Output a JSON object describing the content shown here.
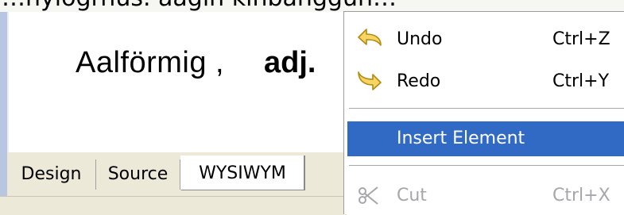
{
  "top_fragment": "…nylogrnus. aagin kinbanggun…",
  "editor": {
    "term": "Aalförmig ,",
    "part_of_speech": "adj."
  },
  "tabs": [
    {
      "label": "Design",
      "active": false
    },
    {
      "label": "Source",
      "active": false
    },
    {
      "label": "WYSIWYM",
      "active": true
    }
  ],
  "context_menu": {
    "undo": {
      "label": "Undo",
      "shortcut": "Ctrl+Z",
      "icon": "undo-arrow-icon"
    },
    "redo": {
      "label": "Redo",
      "shortcut": "Ctrl+Y",
      "icon": "redo-arrow-icon"
    },
    "insert_element": {
      "label": "Insert Element",
      "highlighted": true
    },
    "cut": {
      "label": "Cut",
      "shortcut": "Ctrl+X",
      "icon": "scissors-icon",
      "disabled": true
    }
  },
  "colors": {
    "menu_highlight": "#316ac5",
    "tab_background": "#ece9d8",
    "disabled_text": "#a7a6aa"
  }
}
